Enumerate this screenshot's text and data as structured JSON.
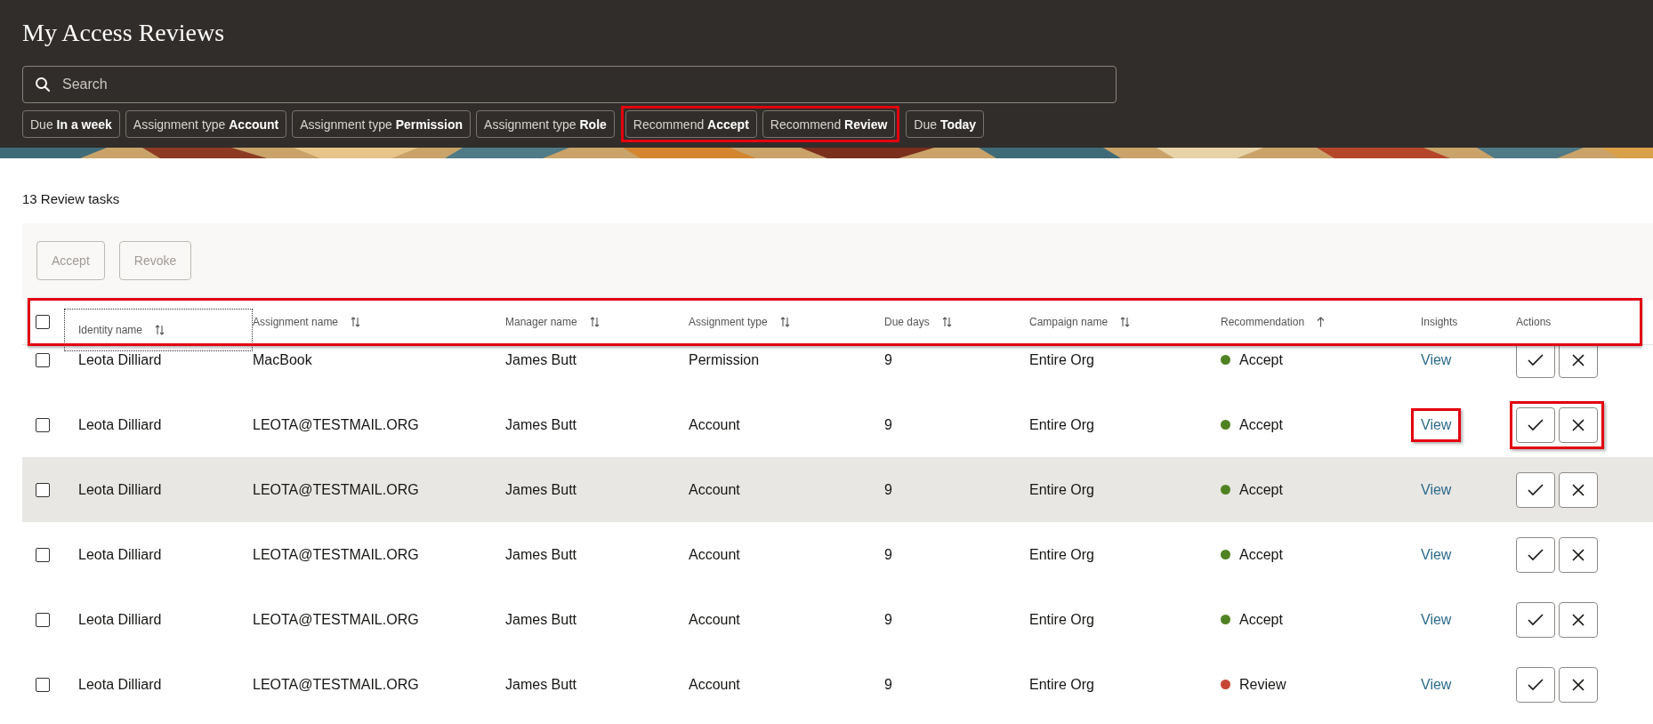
{
  "header": {
    "title": "My Access Reviews",
    "search": {
      "placeholder": "Search"
    },
    "filters": [
      {
        "label": "Due",
        "value": "In a week",
        "highlighted": false
      },
      {
        "label": "Assignment type",
        "value": "Account",
        "highlighted": false
      },
      {
        "label": "Assignment type",
        "value": "Permission",
        "highlighted": false
      },
      {
        "label": "Assignment type",
        "value": "Role",
        "highlighted": false
      },
      {
        "label": "Recommend",
        "value": "Accept",
        "highlighted": true
      },
      {
        "label": "Recommend",
        "value": "Review",
        "highlighted": true
      },
      {
        "label": "Due",
        "value": "Today",
        "highlighted": false
      }
    ]
  },
  "count": "13 Review tasks",
  "toolbar": [
    {
      "label": "Accept",
      "disabled": true
    },
    {
      "label": "Revoke",
      "disabled": true
    }
  ],
  "table": {
    "highlighted": true,
    "select_all": {
      "checked": false
    },
    "columns": [
      {
        "kind": "sortable",
        "label": "Identity name",
        "focused": true
      },
      {
        "kind": "sortable",
        "label": "Assignment name",
        "focused": false
      },
      {
        "kind": "sortable",
        "label": "Manager name",
        "focused": false
      },
      {
        "kind": "sortable",
        "label": "Assignment type",
        "focused": false
      },
      {
        "kind": "sortable",
        "label": "Due days",
        "focused": false
      },
      {
        "kind": "sortable",
        "label": "Campaign name",
        "focused": false
      },
      {
        "kind": "ascending",
        "label": "Recommendation",
        "focused": false
      },
      {
        "kind": "plain",
        "label": "Insights",
        "focused": false
      },
      {
        "kind": "plain",
        "label": "Actions",
        "focused": false
      }
    ],
    "rows": [
      {
        "checked": false,
        "shaded": false,
        "identity": "Leota Dilliard",
        "assignment": "MacBook",
        "manager": "James Butt",
        "type": "Permission",
        "due": "9",
        "campaign": "Entire Org",
        "recommendation": "Accept",
        "color": "#508223",
        "insights": "View",
        "insights_highlighted": false,
        "actions_highlighted": false
      },
      {
        "checked": false,
        "shaded": false,
        "identity": "Leota Dilliard",
        "assignment": "LEOTA@TESTMAIL.ORG",
        "manager": "James Butt",
        "type": "Account",
        "due": "9",
        "campaign": "Entire Org",
        "recommendation": "Accept",
        "color": "#508223",
        "insights": "View",
        "insights_highlighted": true,
        "actions_highlighted": true
      },
      {
        "checked": false,
        "shaded": true,
        "identity": "Leota Dilliard",
        "assignment": "LEOTA@TESTMAIL.ORG",
        "manager": "James Butt",
        "type": "Account",
        "due": "9",
        "campaign": "Entire Org",
        "recommendation": "Accept",
        "color": "#508223",
        "insights": "View",
        "insights_highlighted": false,
        "actions_highlighted": false
      },
      {
        "checked": false,
        "shaded": false,
        "identity": "Leota Dilliard",
        "assignment": "LEOTA@TESTMAIL.ORG",
        "manager": "James Butt",
        "type": "Account",
        "due": "9",
        "campaign": "Entire Org",
        "recommendation": "Accept",
        "color": "#508223",
        "insights": "View",
        "insights_highlighted": false,
        "actions_highlighted": false
      },
      {
        "checked": false,
        "shaded": false,
        "identity": "Leota Dilliard",
        "assignment": "LEOTA@TESTMAIL.ORG",
        "manager": "James Butt",
        "type": "Account",
        "due": "9",
        "campaign": "Entire Org",
        "recommendation": "Accept",
        "color": "#508223",
        "insights": "View",
        "insights_highlighted": false,
        "actions_highlighted": false
      },
      {
        "checked": false,
        "shaded": false,
        "identity": "Leota Dilliard",
        "assignment": "LEOTA@TESTMAIL.ORG",
        "manager": "James Butt",
        "type": "Account",
        "due": "9",
        "campaign": "Entire Org",
        "recommendation": "Review",
        "color": "#c74634",
        "insights": "View",
        "insights_highlighted": false,
        "actions_highlighted": false
      }
    ]
  }
}
